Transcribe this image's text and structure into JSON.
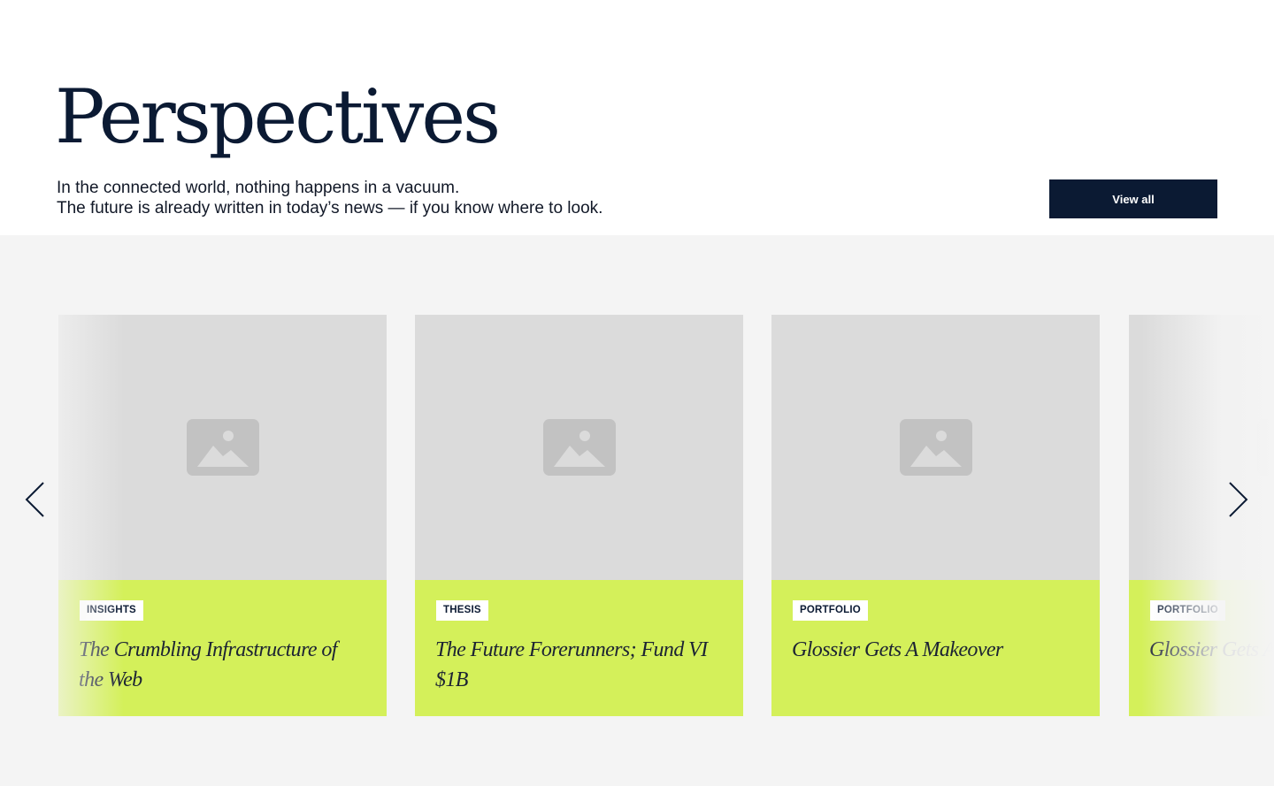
{
  "header": {
    "title": "Perspectives",
    "subtitle_line1": "In the connected world, nothing happens in a vacuum.",
    "subtitle_line2": "The future is already written in today’s news — if you know where to look.",
    "view_all_label": "View all"
  },
  "carousel": {
    "prev_icon": "chevron-left-icon",
    "next_icon": "chevron-right-icon",
    "cards": [
      {
        "tag": "INSIGHTS",
        "title": "The Crumbling Infrastructure of the Web",
        "image_icon": "image-placeholder-icon"
      },
      {
        "tag": "THESIS",
        "title": "The Future Forerunners; Fund VI $1B",
        "image_icon": "image-placeholder-icon"
      },
      {
        "tag": "PORTFOLIO",
        "title": "Glossier Gets A Makeover",
        "image_icon": "image-placeholder-icon"
      },
      {
        "tag": "PORTFOLIO",
        "title": "Glossier Gets A Makeover",
        "image_icon": "image-placeholder-icon"
      }
    ]
  },
  "colors": {
    "navy": "#0b1a33",
    "card_accent": "#d4f05a",
    "image_placeholder": "#dbdbdb",
    "carousel_bg": "#f4f4f4"
  }
}
